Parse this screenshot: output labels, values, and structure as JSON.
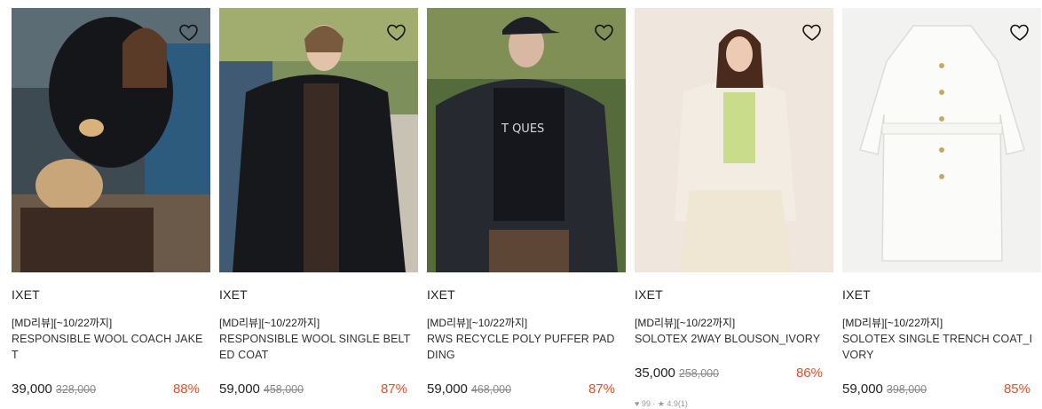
{
  "products": [
    {
      "brand": "IXET",
      "tag": "[MD리뷰][~10/22까지]",
      "name": "RESPONSIBLE WOOL COACH JAKET",
      "price": "39,000",
      "original_price": "328,000",
      "discount": "88%",
      "image": "woman-black-jacket-car",
      "heart_icon": "heart-outline-icon"
    },
    {
      "brand": "IXET",
      "tag": "[MD리뷰][~10/22까지]",
      "name": "RESPONSIBLE WOOL SINGLE BELTED COAT",
      "price": "59,000",
      "original_price": "458,000",
      "discount": "87%",
      "image": "woman-black-wool-coat",
      "heart_icon": "heart-outline-icon"
    },
    {
      "brand": "IXET",
      "tag": "[MD리뷰][~10/22까지]",
      "name": "RWS RECYCLE POLY PUFFER PADDING",
      "price": "59,000",
      "original_price": "468,000",
      "discount": "87%",
      "image": "person-black-puffer",
      "heart_icon": "heart-outline-icon"
    },
    {
      "brand": "IXET",
      "tag": "[MD리뷰][~10/22까지]",
      "name": "SOLOTEX 2WAY BLOUSON_IVORY",
      "price": "35,000",
      "original_price": "258,000",
      "discount": "86%",
      "image": "woman-ivory-blouson",
      "heart_icon": "heart-outline-icon",
      "meta": "♥ 99 · ★ 4.9(1)"
    },
    {
      "brand": "IXET",
      "tag": "[MD리뷰][~10/22까지]",
      "name": "SOLOTEX SINGLE TRENCH COAT_IVORY",
      "price": "59,000",
      "original_price": "398,000",
      "discount": "85%",
      "image": "ivory-trench-coat",
      "heart_icon": "heart-outline-icon"
    }
  ],
  "colors": {
    "discount": "#e2502a",
    "text": "#222222",
    "muted": "#888888"
  }
}
